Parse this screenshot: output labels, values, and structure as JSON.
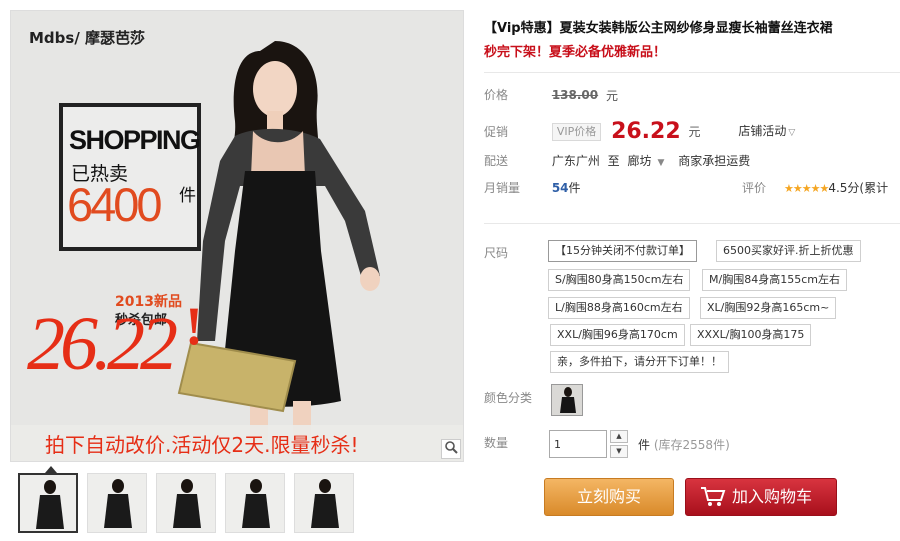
{
  "gallery": {
    "brand": "Mdbs/ 摩瑟芭莎",
    "promo_shopping": "SHOPPING",
    "promo_hot": "已热卖",
    "promo_sold": "6400",
    "promo_unit": "件",
    "new_badge": "2013新品",
    "free_ship": "秒杀包邮",
    "big_price": "26.22",
    "big_exclaim": "!",
    "bottom_banner": "拍下自动改价.活动仅2天.限量秒杀!",
    "zoom_icon": "magnifier-icon",
    "thumbnail_count": 5
  },
  "product": {
    "title": "【Vip特惠】夏装女装韩版公主网纱修身显瘦长袖蕾丝连衣裙",
    "subtitle": "秒完下架！夏季必备优雅新品！"
  },
  "price": {
    "label": "价格",
    "original": "138.00",
    "currency": "元"
  },
  "promo": {
    "label": "促销",
    "tag": "VIP价格",
    "price": "26.22",
    "currency": "元",
    "shop_activity": "店铺活动",
    "dropdown_icon": "chevron-down-icon"
  },
  "shipping": {
    "label": "配送",
    "from": "广东广州",
    "to_word": "至",
    "to": "廊坊",
    "fee": "商家承担运费"
  },
  "sales": {
    "label": "月销量",
    "count": "54",
    "unit": "件",
    "rating_label": "评价",
    "stars": "★★★★★",
    "rating": "4.5分",
    "cumulative": "(累计"
  },
  "size": {
    "label": "尺码",
    "options": [
      "【15分钟关闭不付款订单】",
      "6500买家好评.折上折优惠",
      "S/胸围80身高150cm左右",
      "M/胸围84身高155cm左右",
      "L/胸围88身高160cm左右",
      "XL/胸围92身高165cm~",
      "XXL/胸围96身高170cm",
      "XXXL/胸100身高175",
      "亲，多件拍下，请分开下订单！！"
    ]
  },
  "color": {
    "label": "颜色分类"
  },
  "quantity": {
    "label": "数量",
    "value": "1",
    "unit": "件",
    "stock": "(库存2558件)",
    "up_icon": "chevron-up-icon",
    "down_icon": "chevron-down-icon"
  },
  "actions": {
    "buy_now": "立刻购买",
    "add_to_cart": "加入购物车",
    "cart_icon": "cart-icon"
  },
  "colors": {
    "accent_red": "#c8101b",
    "buy_orange": "#e59a3f",
    "cart_red": "#b81724",
    "promo_orange": "#e14b1f"
  }
}
